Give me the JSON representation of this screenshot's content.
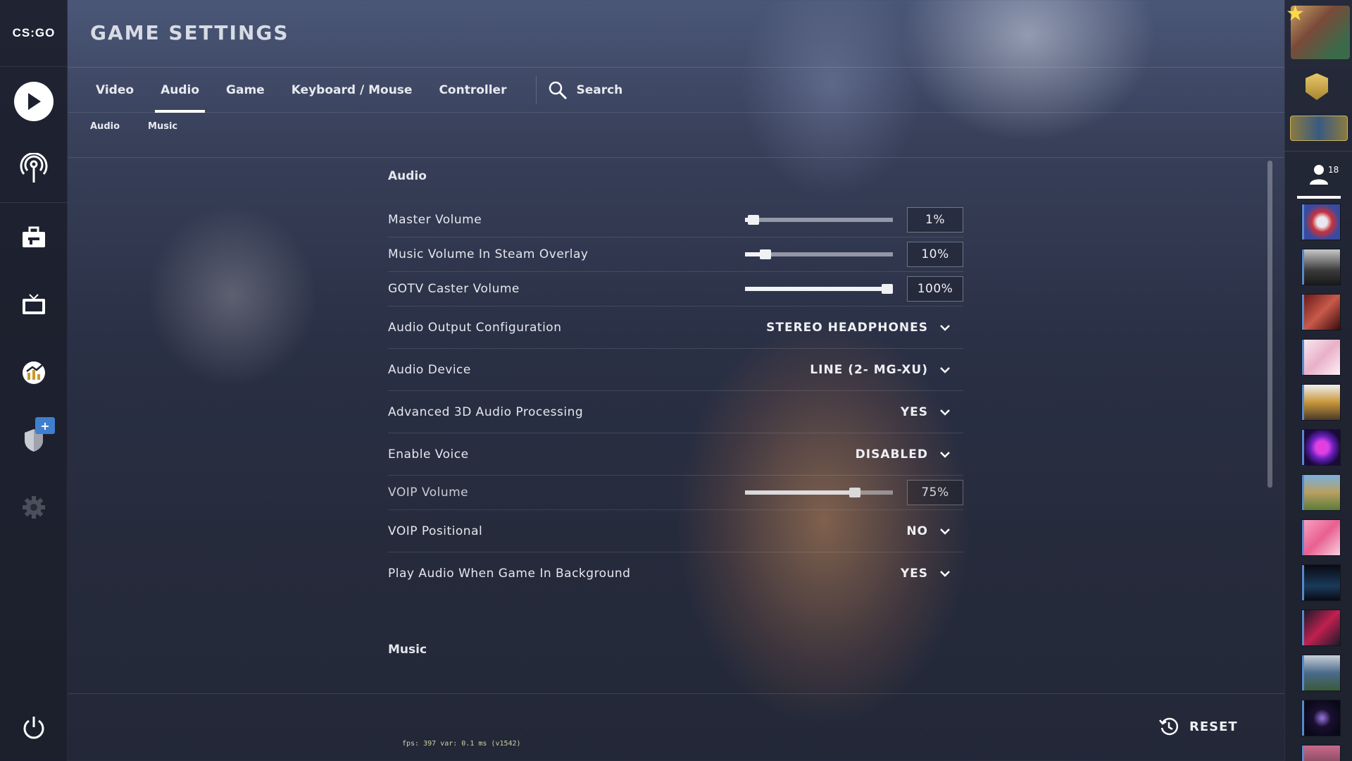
{
  "logo": {
    "text": "CS:GO"
  },
  "header": {
    "title": "GAME SETTINGS"
  },
  "tabs": [
    {
      "label": "Video",
      "active": false
    },
    {
      "label": "Audio",
      "active": true
    },
    {
      "label": "Game",
      "active": false
    },
    {
      "label": "Keyboard / Mouse",
      "active": false
    },
    {
      "label": "Controller",
      "active": false
    }
  ],
  "search": {
    "label": "Search"
  },
  "subtabs": [
    "Audio",
    "Music"
  ],
  "sections": {
    "audio_title": "Audio",
    "music_title": "Music"
  },
  "settings": {
    "master_volume": {
      "label": "Master Volume",
      "value": "1%",
      "level": 0.01
    },
    "music_volume_overlay": {
      "label": "Music Volume In Steam Overlay",
      "value": "10%",
      "level": 0.1
    },
    "gotv_caster_volume": {
      "label": "GOTV Caster Volume",
      "value": "100%",
      "level": 1.0
    },
    "audio_output_config": {
      "label": "Audio Output Configuration",
      "value": "STEREO HEADPHONES"
    },
    "audio_device": {
      "label": "Audio Device",
      "value": "LINE (2- MG-XU)"
    },
    "advanced_3d_audio": {
      "label": "Advanced 3D Audio Processing",
      "value": "YES"
    },
    "enable_voice": {
      "label": "Enable Voice",
      "value": "DISABLED"
    },
    "voip_volume": {
      "label": "VOIP Volume",
      "value": "75%",
      "level": 0.75
    },
    "voip_positional": {
      "label": "VOIP Positional",
      "value": "NO"
    },
    "play_audio_background": {
      "label": "Play Audio When Game In Background",
      "value": "YES"
    }
  },
  "footer": {
    "fps_text": "fps:   397 var:  0.1 ms (v1542)",
    "reset_label": "RESET"
  },
  "friends": {
    "count": "18"
  },
  "icons": {
    "play": "play-icon",
    "broadcast": "broadcast-icon",
    "inventory": "briefcase-icon",
    "watch": "tv-icon",
    "stats": "stats-icon",
    "operation": "shield-icon",
    "settings": "gear-icon",
    "power": "power-icon",
    "reset": "reset-icon",
    "search": "search-icon"
  },
  "colors": {
    "accent": "#ffffff",
    "badge_blue": "#3f7fcf"
  }
}
